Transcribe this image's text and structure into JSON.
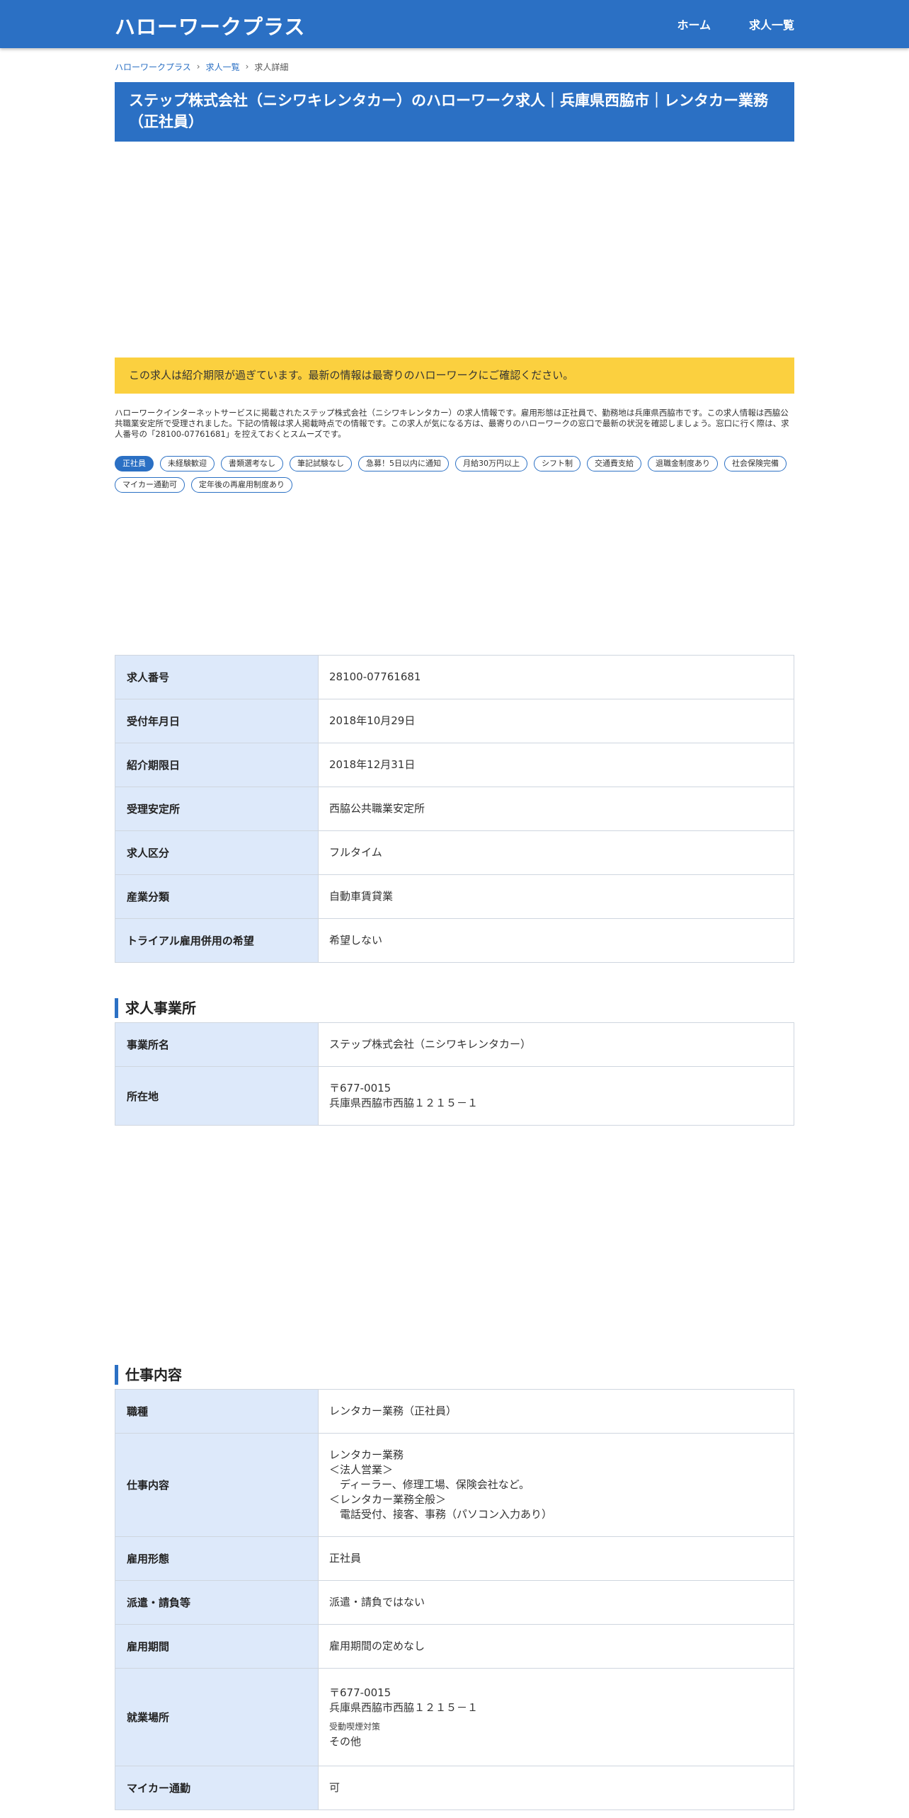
{
  "header": {
    "logo": "ハローワークプラス",
    "nav": [
      "ホーム",
      "求人一覧"
    ]
  },
  "breadcrumb": {
    "items": [
      "ハローワークプラス",
      "求人一覧",
      "求人詳細"
    ]
  },
  "page_title": "ステップ株式会社（ニシワキレンタカー）のハローワーク求人｜兵庫県西脇市｜レンタカー業務（正社員）",
  "notice": "この求人は紹介期限が過ぎています。最新の情報は最寄りのハローワークにご確認ください。",
  "intro": "ハローワークインターネットサービスに掲載されたステップ株式会社（ニシワキレンタカー）の求人情報です。雇用形態は正社員で、勤務地は兵庫県西脇市です。この求人情報は西脇公共職業安定所で受理されました。下記の情報は求人掲載時点での情報です。この求人が気になる方は、最寄りのハローワークの窓口で最新の状況を確認しましょう。窓口に行く際は、求人番号の「28100-07761681」を控えておくとスムーズです。",
  "tags": [
    "正社員",
    "未経験歓迎",
    "書類選考なし",
    "筆記試験なし",
    "急募！5日以内に通知",
    "月給30万円以上",
    "シフト制",
    "交通費支給",
    "退職金制度あり",
    "社会保険完備",
    "マイカー通勤可",
    "定年後の再雇用制度あり"
  ],
  "basic_info": [
    {
      "label": "求人番号",
      "value": "28100-07761681"
    },
    {
      "label": "受付年月日",
      "value": "2018年10月29日"
    },
    {
      "label": "紹介期限日",
      "value": "2018年12月31日"
    },
    {
      "label": "受理安定所",
      "value": "西脇公共職業安定所"
    },
    {
      "label": "求人区分",
      "value": "フルタイム"
    },
    {
      "label": "産業分類",
      "value": "自動車賃貸業"
    },
    {
      "label": "トライアル雇用併用の希望",
      "value": "希望しない"
    }
  ],
  "office": {
    "heading": "求人事業所",
    "name_label": "事業所名",
    "name_value": "ステップ株式会社（ニシワキレンタカー）",
    "address_label": "所在地",
    "postal": "〒677-0015",
    "address": "兵庫県西脇市西脇１２１５－１"
  },
  "job": {
    "heading": "仕事内容",
    "type_label": "職種",
    "type_value": "レンタカー業務（正社員）",
    "content_label": "仕事内容",
    "content_lines": [
      "レンタカー業務",
      "＜法人営業＞",
      "　ディーラー、修理工場、保険会社など。",
      "＜レンタカー業務全般＞",
      "　電話受付、接客、事務（パソコン入力あり）"
    ],
    "employment_label": "雇用形態",
    "employment_value": "正社員",
    "dispatch_label": "派遣・請負等",
    "dispatch_value": "派遣・請負ではない",
    "period_label": "雇用期間",
    "period_value": "雇用期間の定めなし",
    "place_label": "就業場所",
    "place_postal": "〒677-0015",
    "place_address": "兵庫県西脇市西脇１２１５－１",
    "smoking_label": "受動喫煙対策",
    "smoking_value": "その他",
    "car_label": "マイカー通勤",
    "car_value": "可"
  }
}
